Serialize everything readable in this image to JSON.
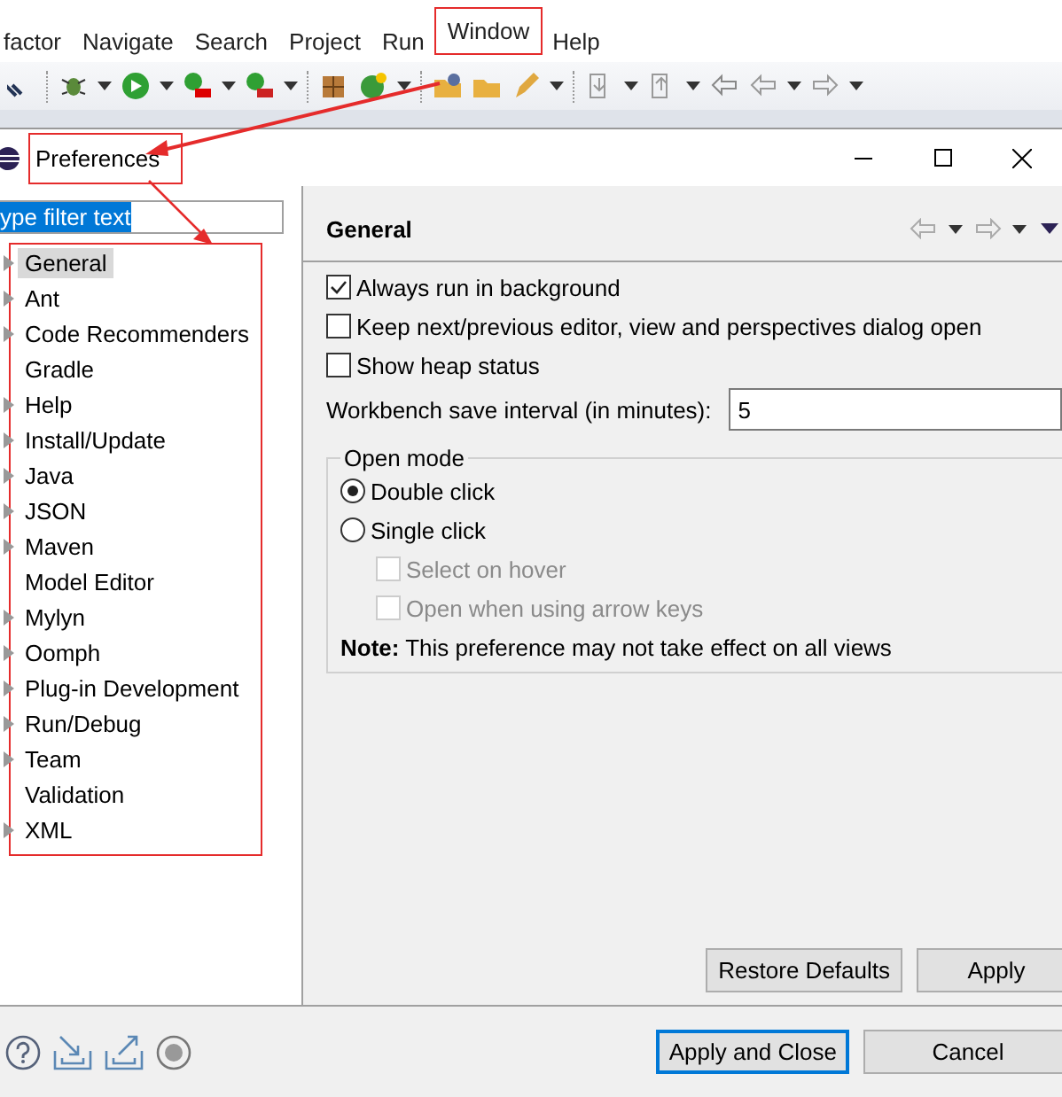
{
  "menu_bar": [
    {
      "label": "factor",
      "highlighted": false
    },
    {
      "label": "Navigate",
      "highlighted": false
    },
    {
      "label": "Search",
      "highlighted": false
    },
    {
      "label": "Project",
      "highlighted": false
    },
    {
      "label": "Run",
      "highlighted": false
    },
    {
      "label": "Window",
      "highlighted": true
    },
    {
      "label": "Help",
      "highlighted": false
    }
  ],
  "dialog": {
    "title": "Preferences"
  },
  "filter": {
    "value": "ype filter text"
  },
  "tree": [
    {
      "label": "General",
      "selected": true,
      "expandable": true
    },
    {
      "label": "Ant",
      "selected": false,
      "expandable": true
    },
    {
      "label": "Code Recommenders",
      "selected": false,
      "expandable": true
    },
    {
      "label": "Gradle",
      "selected": false,
      "expandable": false
    },
    {
      "label": "Help",
      "selected": false,
      "expandable": true
    },
    {
      "label": "Install/Update",
      "selected": false,
      "expandable": true
    },
    {
      "label": "Java",
      "selected": false,
      "expandable": true
    },
    {
      "label": "JSON",
      "selected": false,
      "expandable": true
    },
    {
      "label": "Maven",
      "selected": false,
      "expandable": true
    },
    {
      "label": "Model Editor",
      "selected": false,
      "expandable": false
    },
    {
      "label": "Mylyn",
      "selected": false,
      "expandable": true
    },
    {
      "label": "Oomph",
      "selected": false,
      "expandable": true
    },
    {
      "label": "Plug-in Development",
      "selected": false,
      "expandable": true
    },
    {
      "label": "Run/Debug",
      "selected": false,
      "expandable": true
    },
    {
      "label": "Team",
      "selected": false,
      "expandable": true
    },
    {
      "label": "Validation",
      "selected": false,
      "expandable": false
    },
    {
      "label": "XML",
      "selected": false,
      "expandable": true
    }
  ],
  "page": {
    "title": "General",
    "options": [
      {
        "label": "Always run in background",
        "checked": true
      },
      {
        "label": "Keep next/previous editor, view and perspectives dialog open",
        "checked": false
      },
      {
        "label": "Show heap status",
        "checked": false
      }
    ],
    "save_interval": {
      "label": "Workbench save interval (in minutes):",
      "value": "5"
    },
    "open_mode": {
      "title": "Open mode",
      "choices": [
        {
          "label": "Double click",
          "selected": true
        },
        {
          "label": "Single click",
          "selected": false
        }
      ],
      "sub_options": [
        {
          "label": "Select on hover",
          "checked": false,
          "disabled": true
        },
        {
          "label": "Open when using arrow keys",
          "checked": false,
          "disabled": true
        }
      ],
      "note": "**Note:** This preference may not take effect on all views"
    },
    "buttons": [
      "Restore Defaults",
      "Apply"
    ]
  },
  "footer_buttons": [
    {
      "label": "Apply and Close",
      "default": true
    },
    {
      "label": "Cancel",
      "default": false
    }
  ]
}
